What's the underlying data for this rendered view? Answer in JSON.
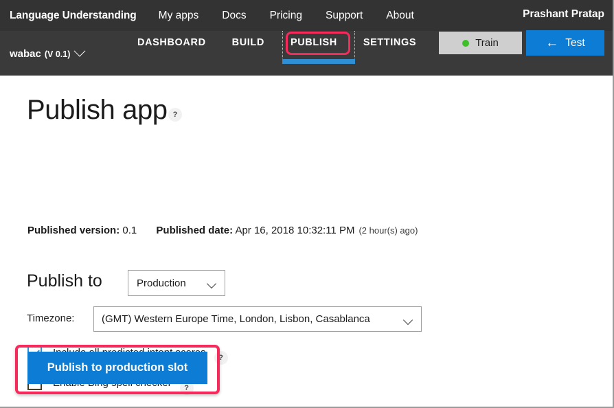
{
  "topnav": {
    "brand": "Language Understanding",
    "links": [
      "My apps",
      "Docs",
      "Pricing",
      "Support",
      "About"
    ],
    "user": "Prashant Pratap"
  },
  "appnav": {
    "app_name": "wabac",
    "app_version": "(V 0.1)",
    "tabs": [
      {
        "label": "DASHBOARD",
        "active": false
      },
      {
        "label": "BUILD",
        "active": false
      },
      {
        "label": "PUBLISH",
        "active": true
      },
      {
        "label": "SETTINGS",
        "active": false
      }
    ],
    "train_label": "Train",
    "test_label": "Test",
    "test_arrow": "←",
    "highlight_color": "#f72a5c",
    "active_tab_underline_color": "#2e8fd4",
    "train_status_color": "#3fbf27"
  },
  "main": {
    "page_title": "Publish app",
    "help_glyph": "?",
    "published_version_label": "Published version:",
    "published_version_value": "0.1",
    "published_date_label": "Published date:",
    "published_date_value": "Apr 16, 2018 10:32:11 PM",
    "published_ago": "(2 hour(s) ago)",
    "publish_to_label": "Publish to",
    "slot_value": "Production",
    "slot_options": [
      "Production"
    ],
    "timezone_label": "Timezone:",
    "timezone_value": "(GMT) Western Europe Time, London, Lisbon, Casablanca",
    "timezone_options": [
      "(GMT) Western Europe Time, London, Lisbon, Casablanca"
    ],
    "checkbox_intent_scores": "Include all predicted intent scores",
    "checkbox_intent_scores_checked": true,
    "checkbox_bing_spell": "Enable Bing spell checker",
    "checkbox_bing_spell_checked": false,
    "publish_button_label": "Publish to production slot",
    "accent_blue": "#0c7cd5",
    "annotation_pink": "#f72a5c"
  }
}
